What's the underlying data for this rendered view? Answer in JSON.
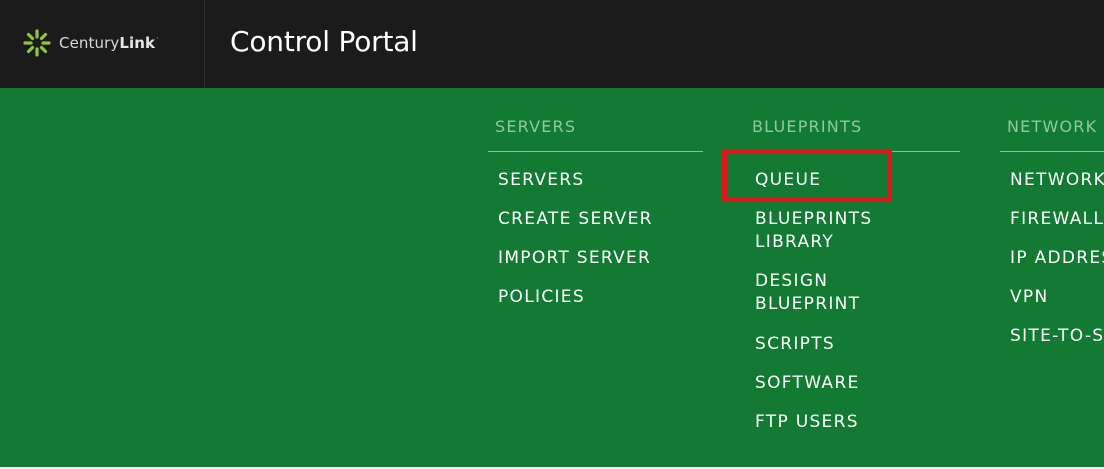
{
  "header": {
    "logo_name_light": "Century",
    "logo_name_bold": "Link",
    "logo_trademark": "·",
    "portal_title": "Control Portal"
  },
  "menu": {
    "columns": [
      {
        "header": "SERVERS",
        "items": [
          "SERVERS",
          "CREATE SERVER",
          "IMPORT SERVER",
          "POLICIES"
        ]
      },
      {
        "header": "BLUEPRINTS",
        "items": [
          "QUEUE",
          "BLUEPRINTS\nLIBRARY",
          "DESIGN\nBLUEPRINT",
          "SCRIPTS",
          "SOFTWARE",
          "FTP USERS"
        ]
      },
      {
        "header": "NETWORK",
        "items": [
          "NETWORKS",
          "FIREWALL",
          "IP ADDRESSES",
          "VPN",
          "SITE-TO-SITE VPN"
        ]
      }
    ]
  },
  "colors": {
    "topbar": "#1b1b1b",
    "menu_background": "#127a33",
    "column_header": "#8fc9a0",
    "highlight": "#e0151f",
    "logo_spark": "#8dc63f"
  },
  "icons": {
    "logo": "centurylink-starburst-icon"
  }
}
